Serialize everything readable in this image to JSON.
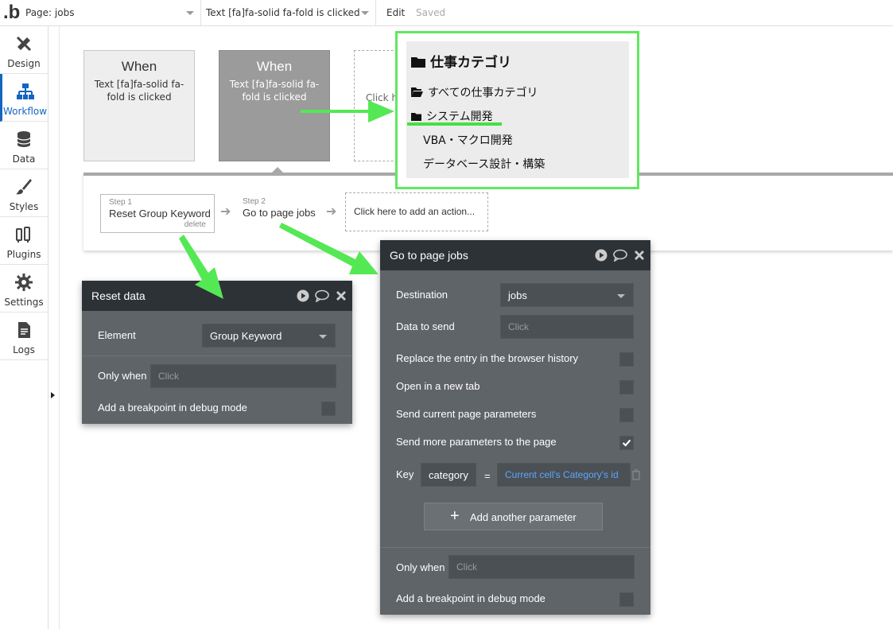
{
  "topbar": {
    "logo": ".b",
    "page_select": "Page: jobs",
    "event_select": "Text [fa]fa-solid fa-fold is clicked",
    "edit_label": "Edit",
    "saved_label": "Saved"
  },
  "sidebar": {
    "items": [
      {
        "label": "Design",
        "icon": "design-icon"
      },
      {
        "label": "Workflow",
        "icon": "workflow-icon"
      },
      {
        "label": "Data",
        "icon": "database-icon"
      },
      {
        "label": "Styles",
        "icon": "brush-icon"
      },
      {
        "label": "Plugins",
        "icon": "plug-icon"
      },
      {
        "label": "Settings",
        "icon": "gear-icon"
      },
      {
        "label": "Logs",
        "icon": "document-icon"
      }
    ]
  },
  "events": [
    {
      "when": "When",
      "desc": "Text [fa]fa-solid fa-fold is clicked"
    },
    {
      "when": "When",
      "desc": "Text [fa]fa-solid fa-fold is clicked"
    }
  ],
  "event_add_label": "Click here to add an event...",
  "steps": [
    {
      "num": "Step 1",
      "name": "Reset Group Keyword",
      "delete": "delete"
    },
    {
      "num": "Step 2",
      "name": "Go to page jobs"
    }
  ],
  "add_action_label": "Click here to add an action...",
  "reset_panel": {
    "title": "Reset data",
    "element_label": "Element",
    "element_value": "Group Keyword",
    "only_when_label": "Only when",
    "only_when_placeholder": "Click",
    "breakpoint_label": "Add a breakpoint in debug mode"
  },
  "goto_panel": {
    "title": "Go to page jobs",
    "destination_label": "Destination",
    "destination_value": "jobs",
    "data_label": "Data to send",
    "data_placeholder": "Click",
    "replace_history_label": "Replace the entry in the browser history",
    "new_tab_label": "Open in a new tab",
    "send_current_label": "Send current page parameters",
    "send_more_label": "Send more parameters to the page",
    "send_more_checked": true,
    "key_label": "Key",
    "key_value": "category",
    "equals": "=",
    "param_value": "Current cell's Category's id",
    "add_param_label": "Add another parameter",
    "only_when_label": "Only when",
    "only_when_placeholder": "Click",
    "breakpoint_label": "Add a breakpoint in debug mode"
  },
  "category_overlay": {
    "title": "仕事カテゴリ",
    "items": [
      "すべての仕事カテゴリ",
      "システム開発",
      "VBA・マクロ開発",
      "データベース設計・構築"
    ]
  },
  "colors": {
    "highlight_green": "#5fe85f",
    "panel_bg": "#5f6468",
    "panel_header": "#2d3236",
    "link_blue": "#5aa7ff",
    "active_blue": "#1565c0"
  }
}
